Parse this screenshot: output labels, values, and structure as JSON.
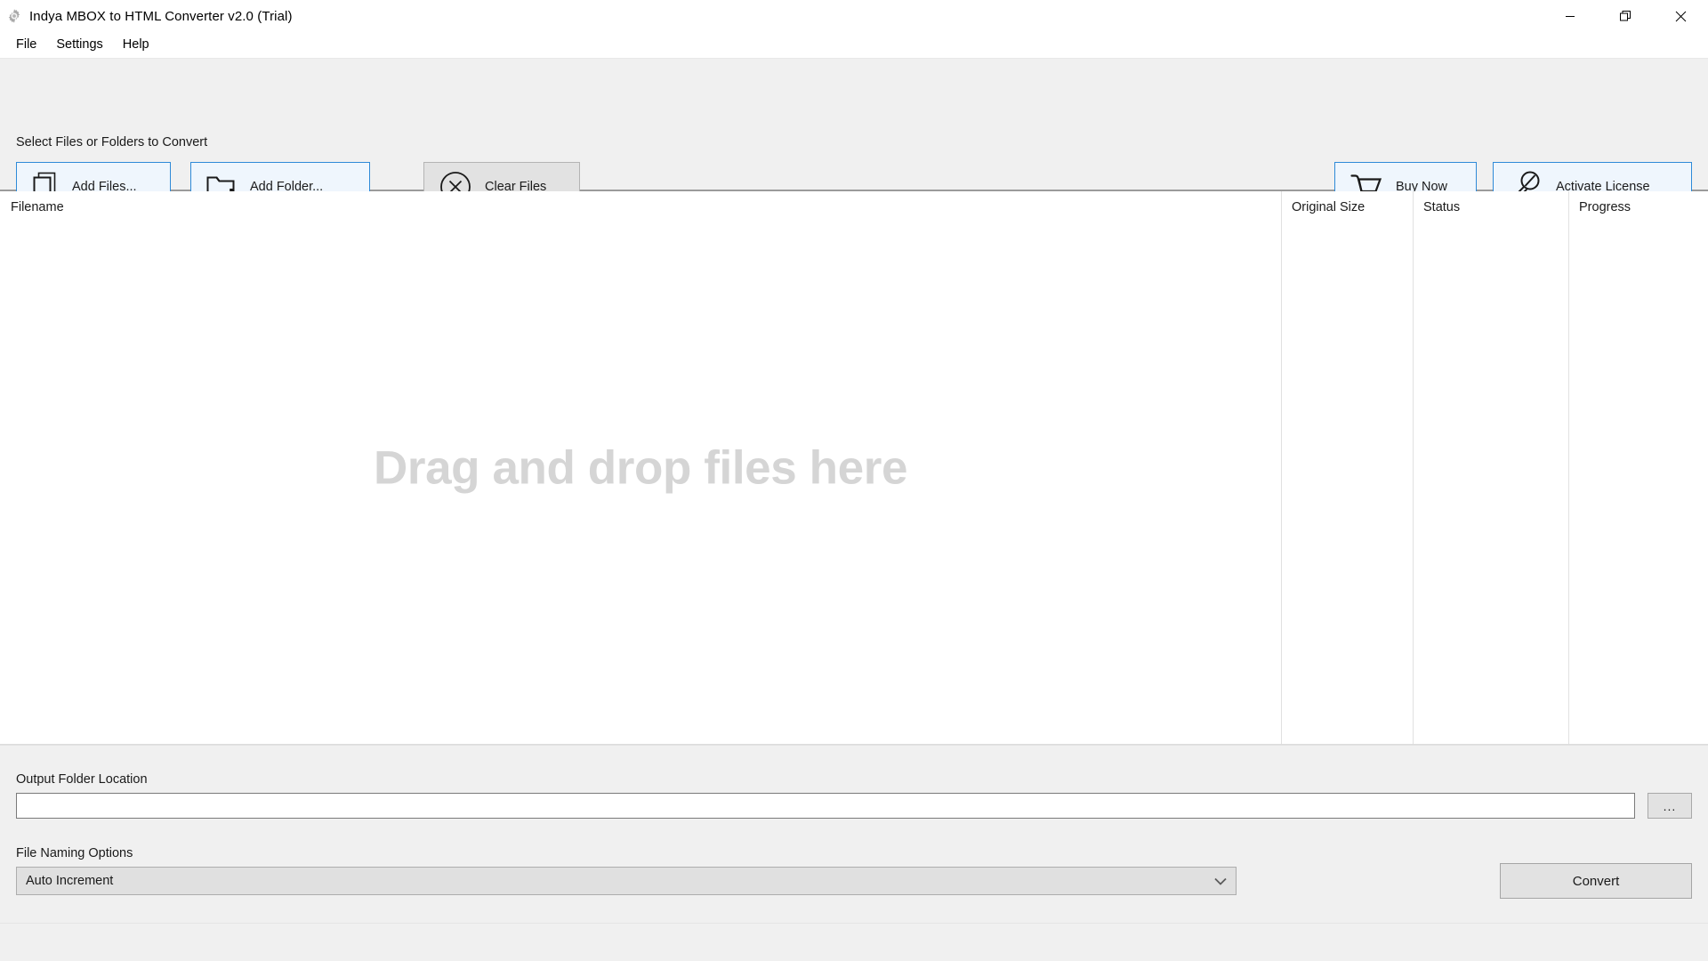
{
  "window": {
    "title": "Indya MBOX to HTML Converter v2.0 (Trial)",
    "icon": "gear-icon",
    "controls": {
      "minimize": "minimize-icon",
      "restore": "restore-icon",
      "close": "close-icon"
    }
  },
  "menubar": {
    "items": [
      {
        "label": "File"
      },
      {
        "label": "Settings"
      },
      {
        "label": "Help"
      }
    ]
  },
  "toolbar": {
    "section_label": "Select Files or Folders to Convert",
    "add_files_label": "Add Files...",
    "add_folder_label": "Add Folder...",
    "clear_files_label": "Clear Files",
    "buy_now_label": "Buy Now",
    "activate_license_label": "Activate License"
  },
  "filelist": {
    "columns": [
      {
        "label": "Filename"
      },
      {
        "label": "Original Size"
      },
      {
        "label": "Status"
      },
      {
        "label": "Progress"
      }
    ],
    "rows": [],
    "empty_text": "Drag and drop files here"
  },
  "output": {
    "label": "Output Folder Location",
    "value": "",
    "placeholder": "",
    "browse_label": "..."
  },
  "naming": {
    "label": "File Naming Options",
    "selected": "Auto Increment"
  },
  "actions": {
    "convert_label": "Convert"
  },
  "statusbar": {
    "text": ""
  },
  "colors": {
    "accent_border": "#2e8ad8",
    "accent_fill": "#eff6fd",
    "panel": "#f0f0f0",
    "button_grey": "#e2e2e2",
    "placeholder_text": "#d5d5d5"
  }
}
